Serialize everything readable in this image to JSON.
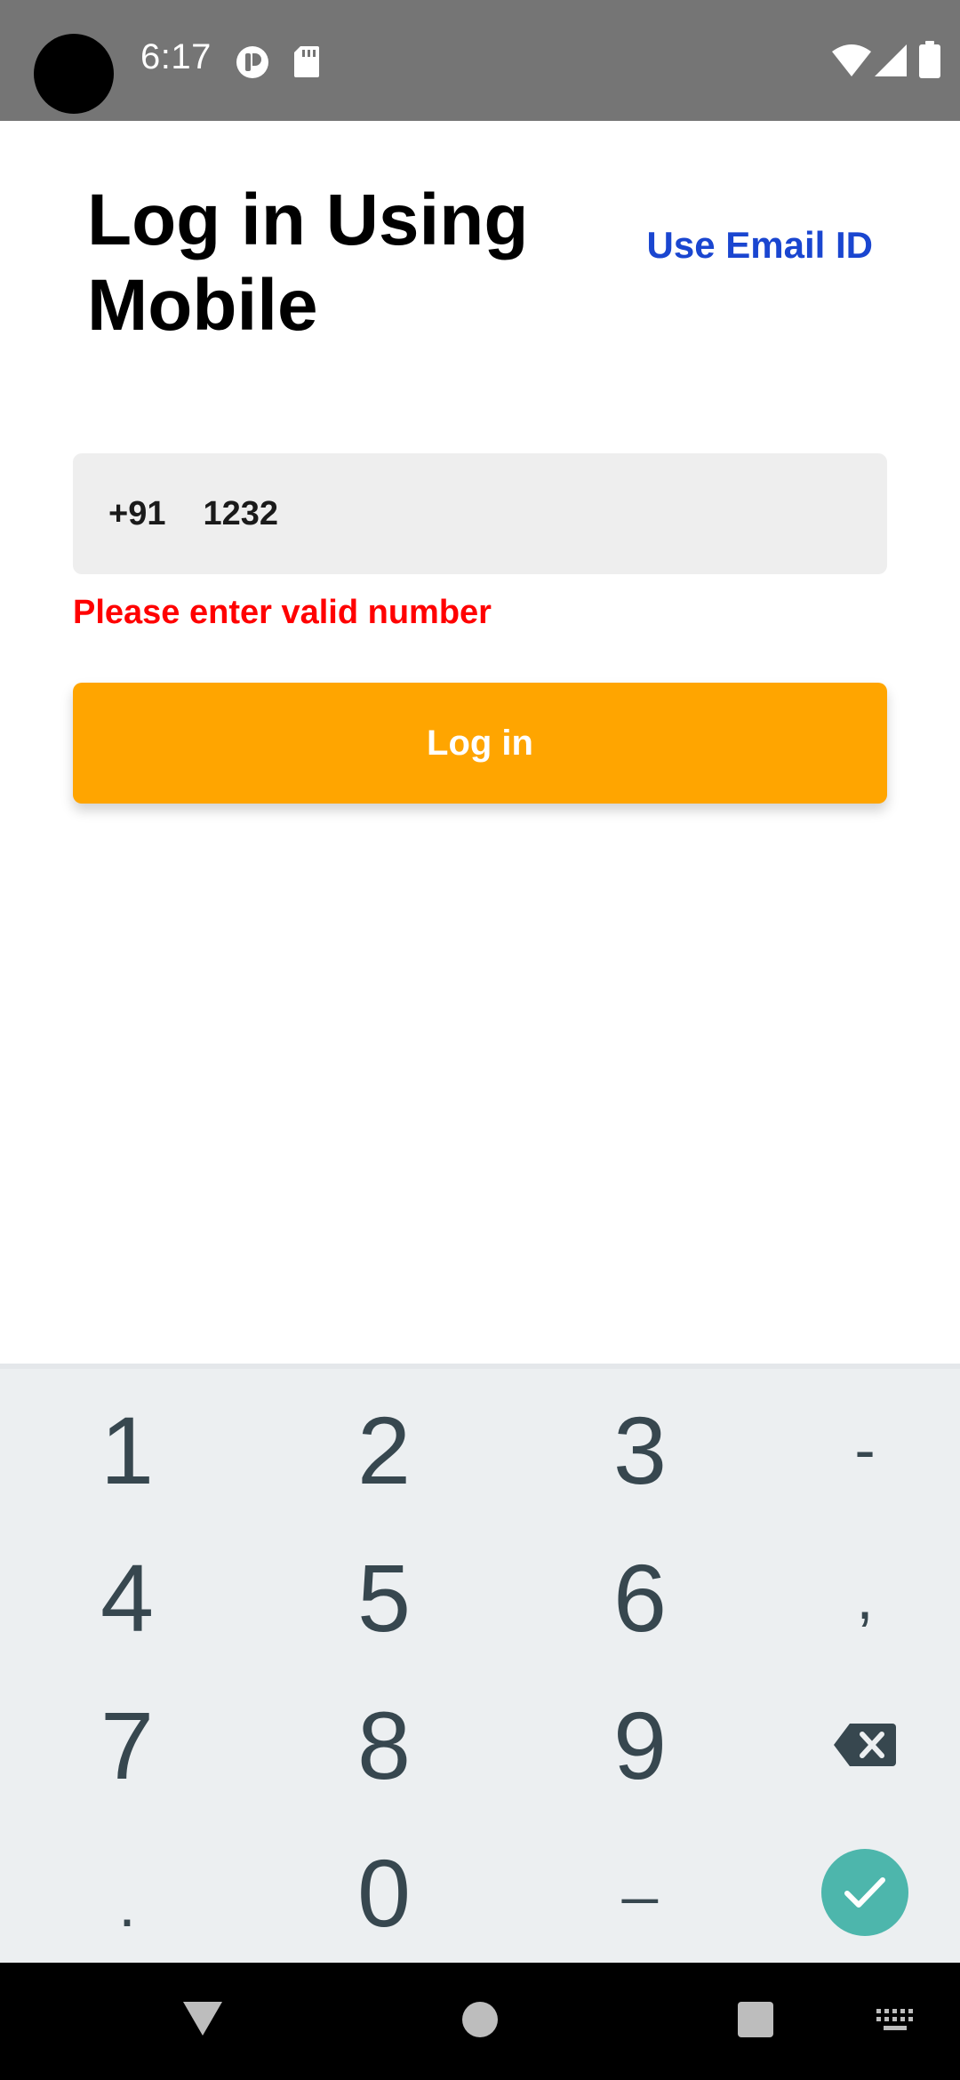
{
  "status_bar": {
    "time": "6:17",
    "icons": [
      "camera-cutout",
      "app-notification-icon",
      "sd-card-icon",
      "wifi-icon",
      "signal-icon",
      "battery-icon"
    ]
  },
  "header": {
    "title": "Log in Using Mobile",
    "alt_login_link": "Use Email ID"
  },
  "phone_field": {
    "country_code": "+91",
    "value": "1232"
  },
  "error_message": "Please enter valid number",
  "login_button": "Log in",
  "keyboard": {
    "keys": [
      "1",
      "2",
      "3",
      "-",
      "4",
      "5",
      "6",
      ",",
      "7",
      "8",
      "9",
      ".",
      "0",
      "_"
    ],
    "backspace_icon": "backspace-icon",
    "done_icon": "check-icon"
  },
  "nav_bar": {
    "icons": [
      "back-icon",
      "home-icon",
      "recents-icon",
      "keyboard-switch-icon"
    ]
  },
  "colors": {
    "status_bar": "#757575",
    "link": "#1a46d0",
    "error": "#ff0000",
    "primary_button": "#ffa500",
    "field_background": "#eeeeee",
    "keyboard_background": "#eceff1",
    "keyboard_text": "#37474f",
    "done_key": "#4db6ac"
  }
}
